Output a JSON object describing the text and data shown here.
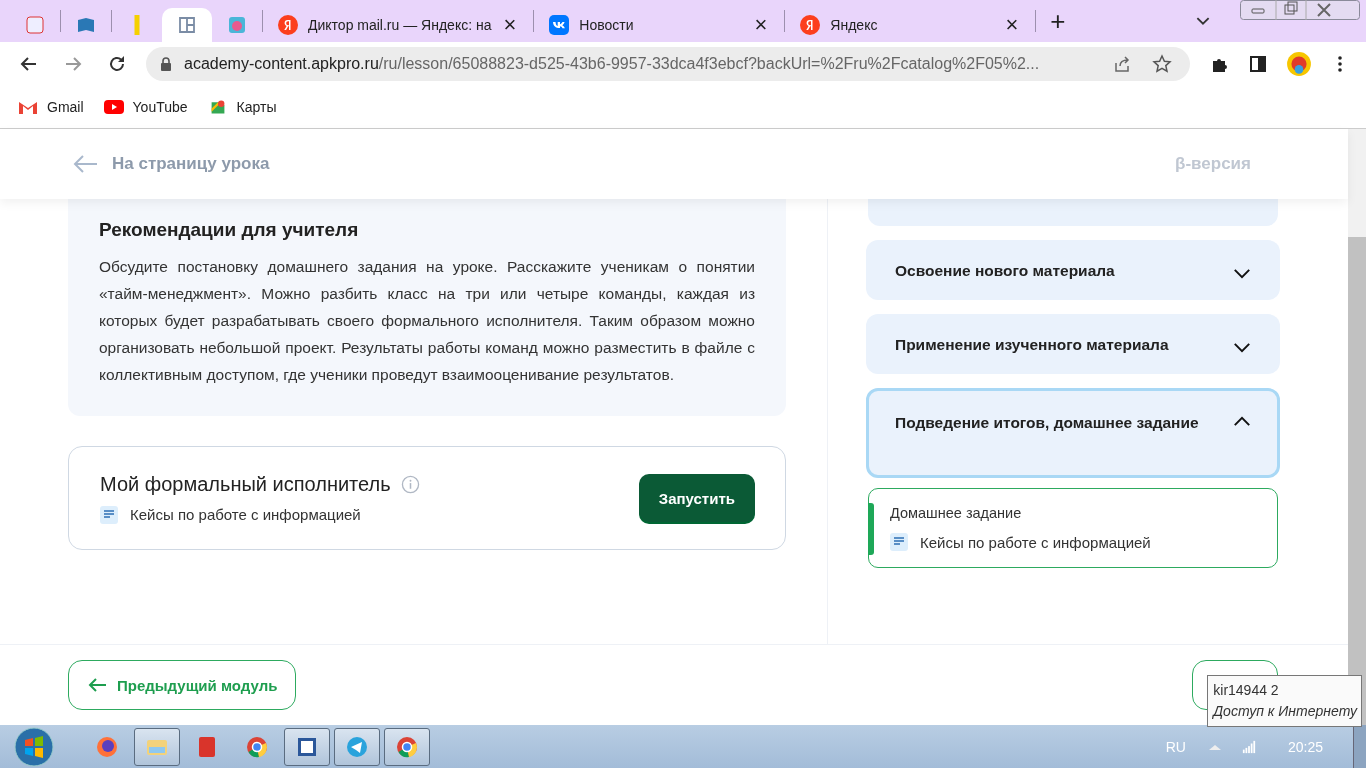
{
  "browser": {
    "tabs": [
      {
        "selected": false
      },
      {
        "selected": false
      },
      {
        "selected": false
      },
      {
        "selected": true
      },
      {
        "selected": false
      },
      {
        "title": "Диктор mail.ru — Яндекс: на",
        "close": "×",
        "selected": false
      },
      {
        "title": "Новости",
        "close": "×",
        "selected": false
      },
      {
        "title": "Яндекс",
        "close": "×",
        "selected": false
      }
    ],
    "new_tab": "+",
    "address": {
      "host": "academy-content.apkpro.ru",
      "path": "/ru/lesson/65088823-d525-43b6-9957-33dca4f3ebcf?backUrl=%2Fru%2Fcatalog%2F05%2..."
    },
    "bookmarks": [
      "Gmail",
      "YouTube",
      "Карты"
    ]
  },
  "header": {
    "back": "На страницу урока",
    "beta": "β-версия"
  },
  "recommendations": {
    "title": "Рекомендации для учителя",
    "text": "Обсудите постановку домашнего задания на уроке. Расскажите ученикам о понятии «тайм-менеджмент». Можно разбить класс на три или четыре команды, каждая из которых будет разрабатывать своего формального исполнителя. Таким образом можно организовать небольшой проект. Результаты работы команд можно разместить в файле с коллективным доступом, где ученики проведут взаимооценивание результатов."
  },
  "executor": {
    "title": "Мой формальный исполнитель",
    "file": "Кейсы по работе с информацией",
    "button": "Запустить"
  },
  "stages": [
    {
      "title": "Освоение нового материала",
      "expanded": false,
      "selected": false
    },
    {
      "title": "Применение изученного материала",
      "expanded": false,
      "selected": false
    },
    {
      "title": "Подведение итогов, домашнее задание",
      "expanded": true,
      "selected": true,
      "content": {
        "title": "Домашнее задание",
        "file": "Кейсы по работе с информацией"
      }
    }
  ],
  "footer": {
    "prev": "Предыдущий модуль"
  },
  "tooltip": {
    "name": "kir14944  2",
    "status": "Доступ к Интернету"
  },
  "taskbar": {
    "apps": [
      {
        "open": false
      },
      {
        "open": true
      },
      {
        "open": false
      },
      {
        "open": false
      },
      {
        "open": true
      },
      {
        "open": true
      },
      {
        "open": true
      }
    ],
    "lang": "RU",
    "time": "20:25"
  }
}
